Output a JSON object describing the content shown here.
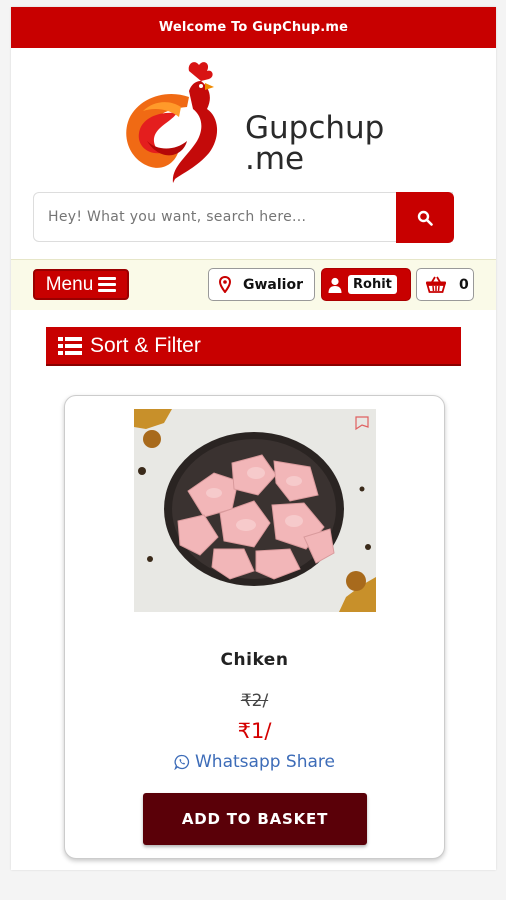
{
  "topbar": {
    "welcome": "Welcome To GupChup.me"
  },
  "logo": {
    "line1": "Gupchup",
    "line2": ".me"
  },
  "search": {
    "placeholder": "Hey! What you want, search here..."
  },
  "nav": {
    "menu_label": "Menu",
    "location": "Gwalior",
    "user": "Rohit",
    "cart_count": "0"
  },
  "sort_filter": {
    "label": "Sort & Filter"
  },
  "product": {
    "name": "Chiken",
    "old_price": "₹2/",
    "new_price": "₹1/",
    "share_label": "Whatsapp Share",
    "add_label": "ADD TO BASKET"
  },
  "colors": {
    "brand_red": "#c80000",
    "button_dark": "#5a0008",
    "link_blue": "#3d6cb8"
  }
}
